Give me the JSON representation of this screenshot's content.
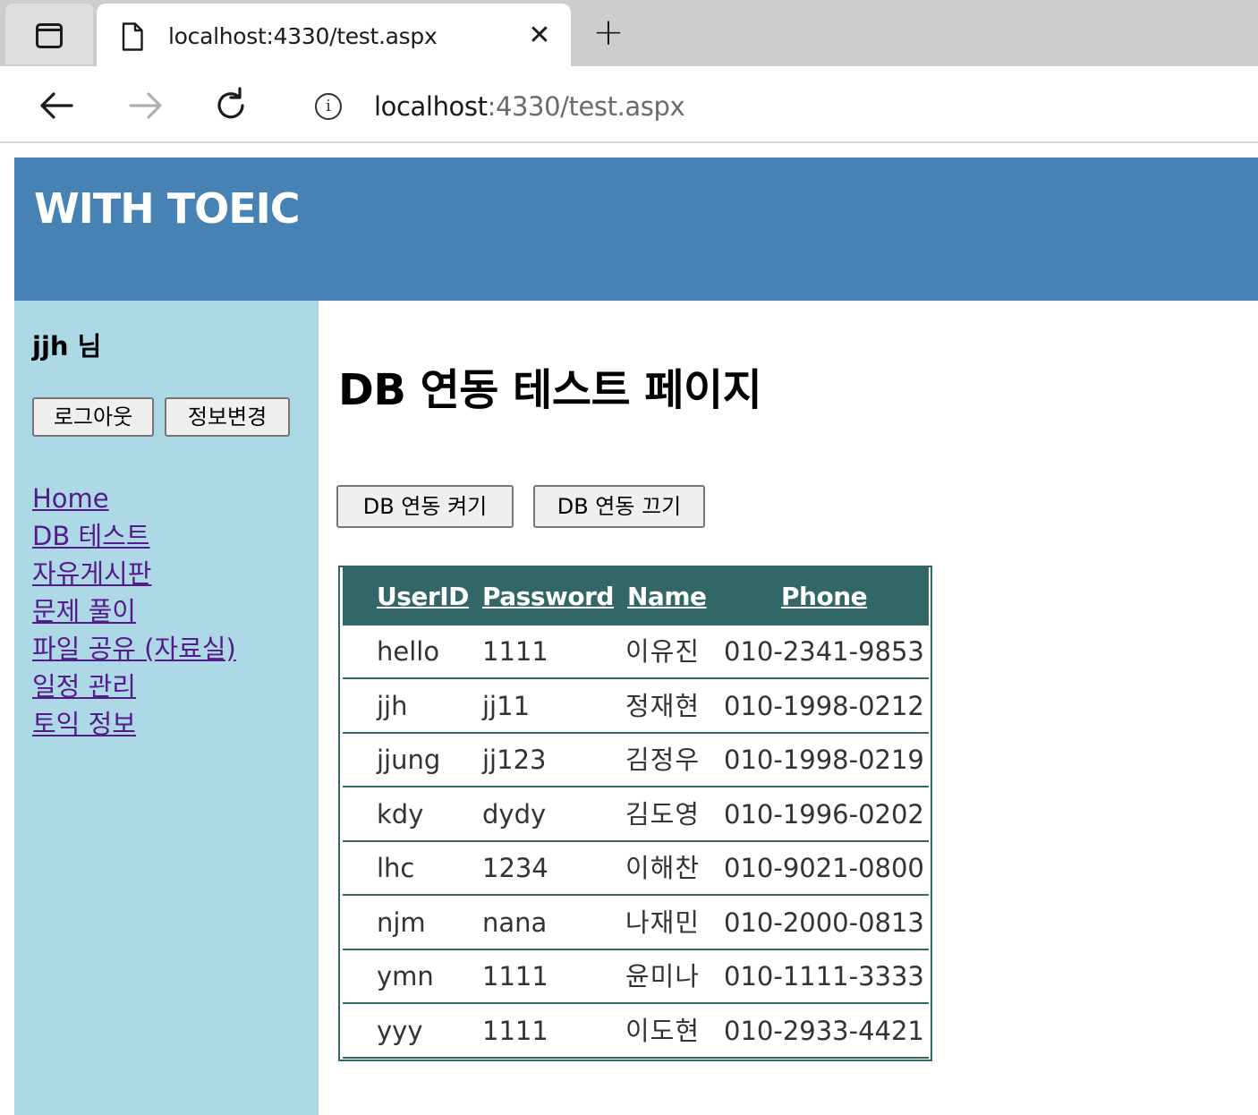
{
  "browser": {
    "tab_title": "localhost:4330/test.aspx",
    "close_glyph": "✕",
    "new_tab_glyph": "+",
    "url_host": "localhost",
    "url_rest": ":4330/test.aspx",
    "info_glyph": "i"
  },
  "header": {
    "brand": "WITH TOEIC",
    "background": "#4682b4"
  },
  "sidebar": {
    "user_label": "jjh 님",
    "logout_label": "로그아웃",
    "edit_info_label": "정보변경",
    "links": [
      "Home",
      "DB 테스트",
      "자유게시판",
      "문제 풀이",
      "파일 공유 (자료실)",
      "일정 관리",
      "토익 정보"
    ],
    "background": "#add8e6"
  },
  "main": {
    "title": "DB 연동 테스트 페이지",
    "db_on_label": "DB 연동 켜기",
    "db_off_label": "DB 연동 끄기",
    "grid": {
      "header_color": "#336666",
      "columns": [
        "UserID",
        "Password",
        "Name",
        "Phone"
      ],
      "rows": [
        [
          "hello",
          "1111",
          "이유진",
          "010-2341-9853"
        ],
        [
          "jjh",
          "jj11",
          "정재현",
          "010-1998-0212"
        ],
        [
          "jjung",
          "jj123",
          "김정우",
          "010-1998-0219"
        ],
        [
          "kdy",
          "dydy",
          "김도영",
          "010-1996-0202"
        ],
        [
          "lhc",
          "1234",
          "이해찬",
          "010-9021-0800"
        ],
        [
          "njm",
          "nana",
          "나재민",
          "010-2000-0813"
        ],
        [
          "ymn",
          "1111",
          "윤미나",
          "010-1111-3333"
        ],
        [
          "yyy",
          "1111",
          "이도현",
          "010-2933-4421"
        ]
      ]
    }
  }
}
